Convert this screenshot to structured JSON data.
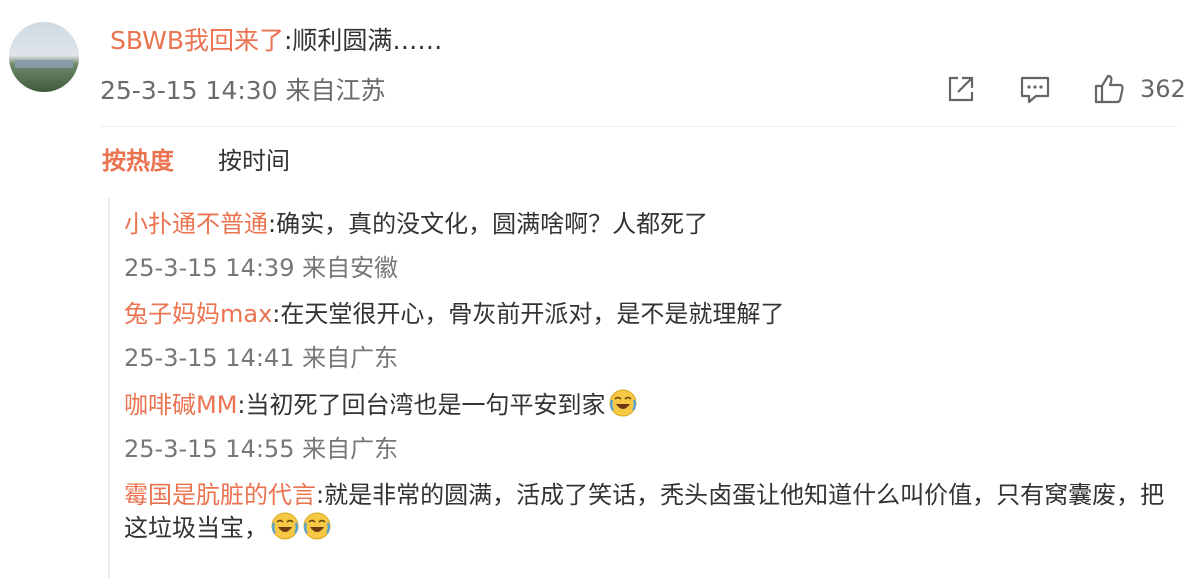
{
  "post": {
    "author": "SBWB我回来了",
    "text": ":顺利圆满……",
    "timestamp": "25-3-15 14:30",
    "location": "来自江苏",
    "like_count": "362",
    "icons": [
      "share-icon",
      "comment-icon",
      "like-icon"
    ]
  },
  "sort_tabs": {
    "hot": "按热度",
    "time": "按时间",
    "active": "hot"
  },
  "replies": [
    {
      "user": "小扑通不普通",
      "text": ":确实，真的没文化，圆满啥啊？人都死了",
      "timestamp": "25-3-15 14:39",
      "location": "来自安徽",
      "emoji_count": 0
    },
    {
      "user": "兔子妈妈max",
      "text": ":在天堂很开心，骨灰前开派对，是不是就理解了",
      "timestamp": "25-3-15 14:41",
      "location": "来自广东",
      "emoji_count": 0
    },
    {
      "user": "咖啡碱MM",
      "text": ":当初死了回台湾也是一句平安到家",
      "timestamp": "25-3-15 14:55",
      "location": "来自广东",
      "emoji_count": 1
    },
    {
      "user": "霉国是肮脏的代言",
      "text": ":就是非常的圆满，活成了笑话，秃头卤蛋让他知道什么叫价值，只有窝囊废，把这垃圾当宝，",
      "timestamp": "",
      "location": "",
      "emoji_count": 2
    }
  ],
  "colors": {
    "accent": "#eb7350",
    "text": "#333333",
    "meta": "#777777"
  }
}
